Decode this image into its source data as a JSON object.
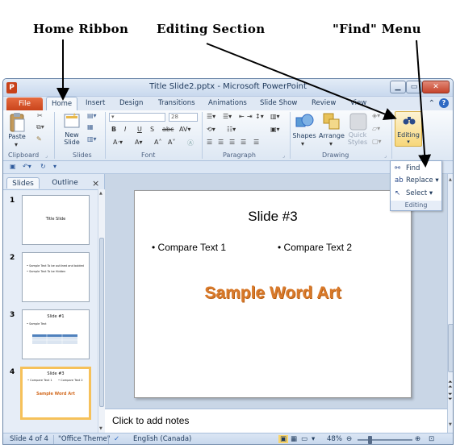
{
  "annotations": {
    "home_ribbon": "Home Ribbon",
    "editing_section": "Editing Section",
    "find_menu": "\"Find\" Menu"
  },
  "window": {
    "title": "Title Slide2.pptx - Microsoft PowerPoint",
    "app_icon_letter": "P"
  },
  "tabs": {
    "file": "File",
    "home": "Home",
    "insert": "Insert",
    "design": "Design",
    "transitions": "Transitions",
    "animations": "Animations",
    "slide_show": "Slide Show",
    "review": "Review",
    "view": "View",
    "help_icon": "?"
  },
  "ribbon": {
    "paste_label": "Paste",
    "new_slide_label": "New\nSlide",
    "font_size": "28",
    "shapes_label": "Shapes",
    "arrange_label": "Arrange",
    "quick_styles_label": "Quick\nStyles",
    "editing_label": "Editing",
    "groups": {
      "clipboard": "Clipboard",
      "slides": "Slides",
      "font": "Font",
      "paragraph": "Paragraph",
      "drawing": "Drawing"
    }
  },
  "editing_menu": {
    "find": "Find",
    "replace": "Replace",
    "select": "Select",
    "footer": "Editing"
  },
  "panel": {
    "tab_slides": "Slides",
    "tab_outline": "Outline",
    "close": "×",
    "thumbs": [
      {
        "num": "1",
        "title": "Title Slide"
      },
      {
        "num": "2",
        "bullet1": "• Sample Text To be outlined and bolded",
        "bullet2": "• Sample Text To be Hidden"
      },
      {
        "num": "3",
        "title": "Slide #1",
        "bullet1": "• Sample Text"
      },
      {
        "num": "4",
        "title": "Slide #3",
        "bullet1": "• Compare Text 1",
        "bullet2": "• Compare Text 2",
        "wordart": "Sample Word Art"
      }
    ]
  },
  "slide": {
    "title": "Slide #3",
    "bullet1": "Compare Text 1",
    "bullet2": "Compare Text 2",
    "wordart": "Sample Word Art"
  },
  "notes": {
    "placeholder": "Click to add notes"
  },
  "status": {
    "slide_count": "Slide 4 of 4",
    "theme": "\"Office Theme\"",
    "language": "English (Canada)",
    "zoom": "48%"
  }
}
